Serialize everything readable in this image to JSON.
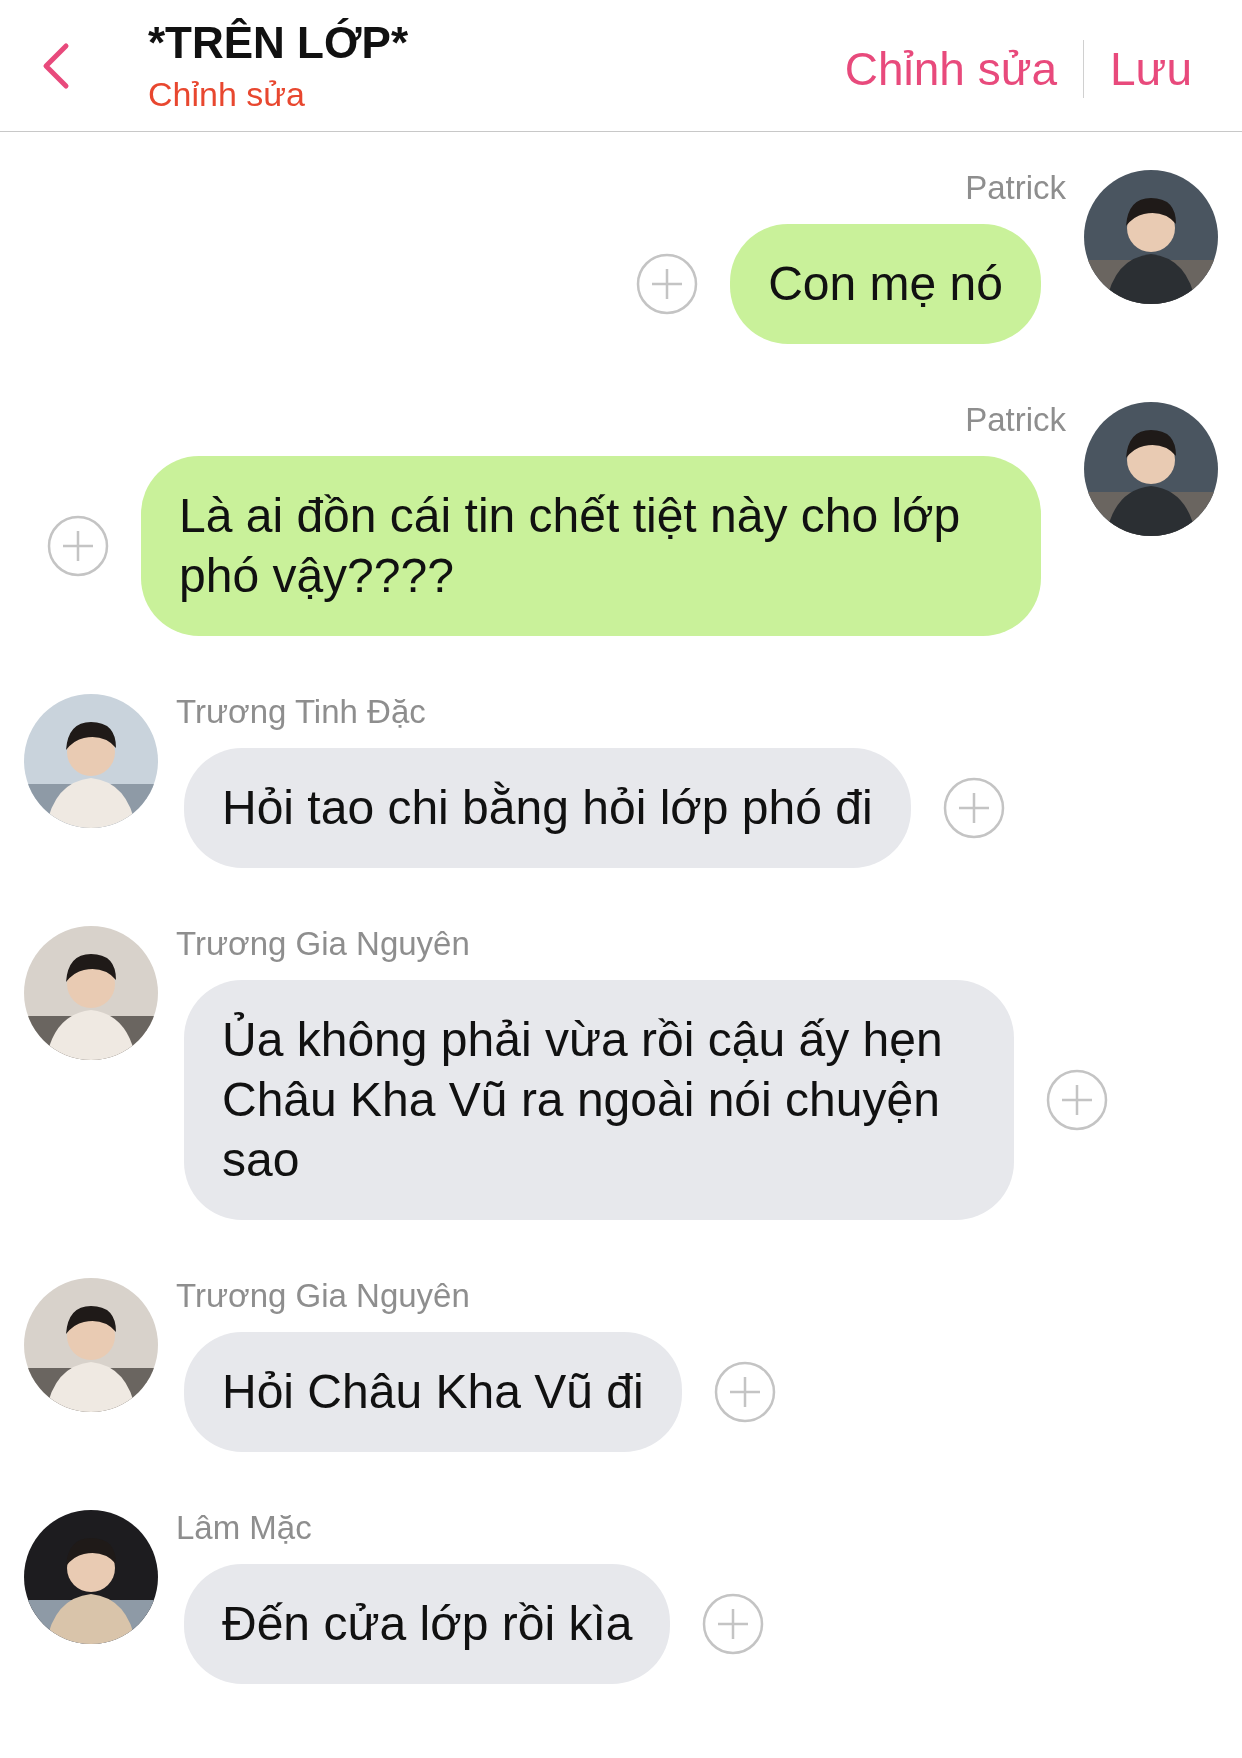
{
  "header": {
    "title": "*TRÊN LỚP*",
    "subtitle": "Chỉnh sửa",
    "actions": [
      "Chỉnh sửa",
      "Lưu"
    ]
  },
  "messages": [
    {
      "kind": "outgoing",
      "sender": "Patrick",
      "text": "Con mẹ nó"
    },
    {
      "kind": "outgoing",
      "sender": "Patrick",
      "text": "Là ai đồn cái tin chết tiệt này cho lớp phó vậy????"
    },
    {
      "kind": "incoming",
      "sender": "Trương Tinh Đặc",
      "text": "Hỏi tao chi bằng hỏi lớp phó đi"
    },
    {
      "kind": "incoming",
      "sender": "Trương Gia Nguyên",
      "text": "Ủa không phải vừa rồi cậu ấy hẹn Châu Kha Vũ ra ngoài nói chuyện sao"
    },
    {
      "kind": "incoming",
      "sender": "Trương Gia Nguyên",
      "text": "Hỏi Châu Kha Vũ đi"
    },
    {
      "kind": "incoming",
      "sender": "Lâm Mặc",
      "text": "Đến cửa lớp rồi kìa"
    }
  ]
}
